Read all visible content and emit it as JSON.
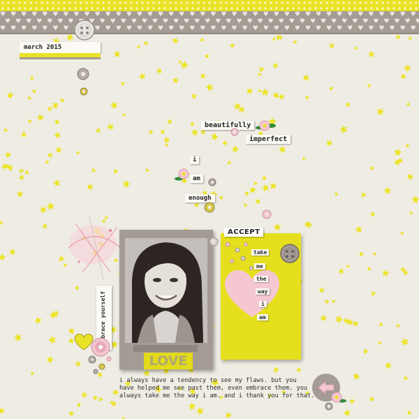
{
  "header": {
    "date": "march 2015"
  },
  "title_words": {
    "line1": "beautifully",
    "line2": "imperfect"
  },
  "stack_words": {
    "w1": "i",
    "w2": "am",
    "w3": "enough"
  },
  "side_tag": {
    "text": "embrace yourself"
  },
  "photo_card": {
    "caption": "LOVE"
  },
  "yellow_card": {
    "title": "ACCEPT",
    "words": [
      "take",
      "me",
      "the",
      "way",
      "i",
      "am"
    ]
  },
  "journaling": {
    "line1": "i always have a tendency to see my flaws. but you",
    "line2": "have helped me see past them, even embrace them. you",
    "line3": "always take me the way i am. and i thank you for that."
  },
  "colors": {
    "background": "#efece4",
    "accent_yellow": "#e6df1d",
    "band_grey": "#a59c93",
    "heart_pink": "#f4c7d1"
  }
}
